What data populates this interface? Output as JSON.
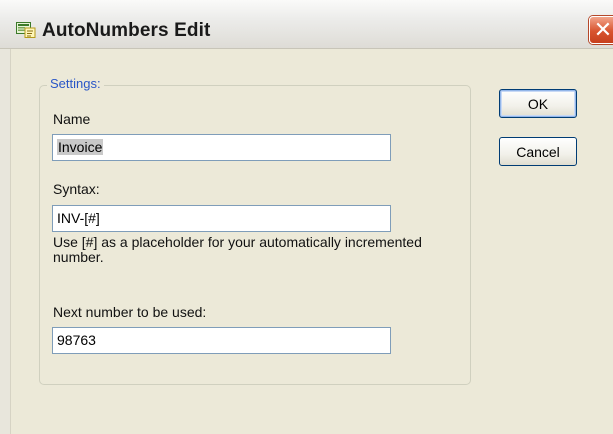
{
  "window": {
    "title": "AutoNumbers Edit",
    "icon": "autonumbers-app-icon",
    "close_glyph": "✕"
  },
  "settings_group": {
    "legend": "Settings:"
  },
  "name_field": {
    "label": "Name",
    "value": "Invoice"
  },
  "syntax_field": {
    "label": "Syntax:",
    "value": "INV-[#]",
    "help": "Use [#] as a placeholder for your automatically incremented number."
  },
  "next_number_field": {
    "label": "Next number to be used:",
    "value": "98763"
  },
  "buttons": {
    "ok": "OK",
    "cancel": "Cancel"
  },
  "colors": {
    "dialog_bg": "#ece9d8",
    "legend_text": "#2a57c7",
    "close_button": "#d8542f",
    "field_border": "#7f9db9"
  }
}
